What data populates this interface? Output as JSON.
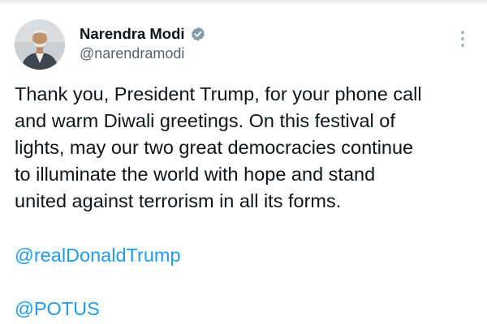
{
  "author": {
    "display_name": "Narendra Modi",
    "handle": "@narendramodi",
    "verified": true,
    "avatar_icon": "profile-photo"
  },
  "tweet": {
    "text_lines": [
      "Thank you, President Trump, for your phone call",
      "and warm Diwali greetings. On this festival of",
      "lights, may our two great democracies continue",
      "to illuminate the world with hope and stand",
      "united against terrorism in all its forms."
    ],
    "mentions": [
      "@realDonaldTrump",
      "@POTUS"
    ]
  },
  "colors": {
    "text": "#0f1419",
    "secondary_text": "#536471",
    "link": "#1d9bf0",
    "verified_badge": "#829aab"
  },
  "icons": {
    "verified": "verified-badge-icon",
    "more": "more-options-icon"
  }
}
